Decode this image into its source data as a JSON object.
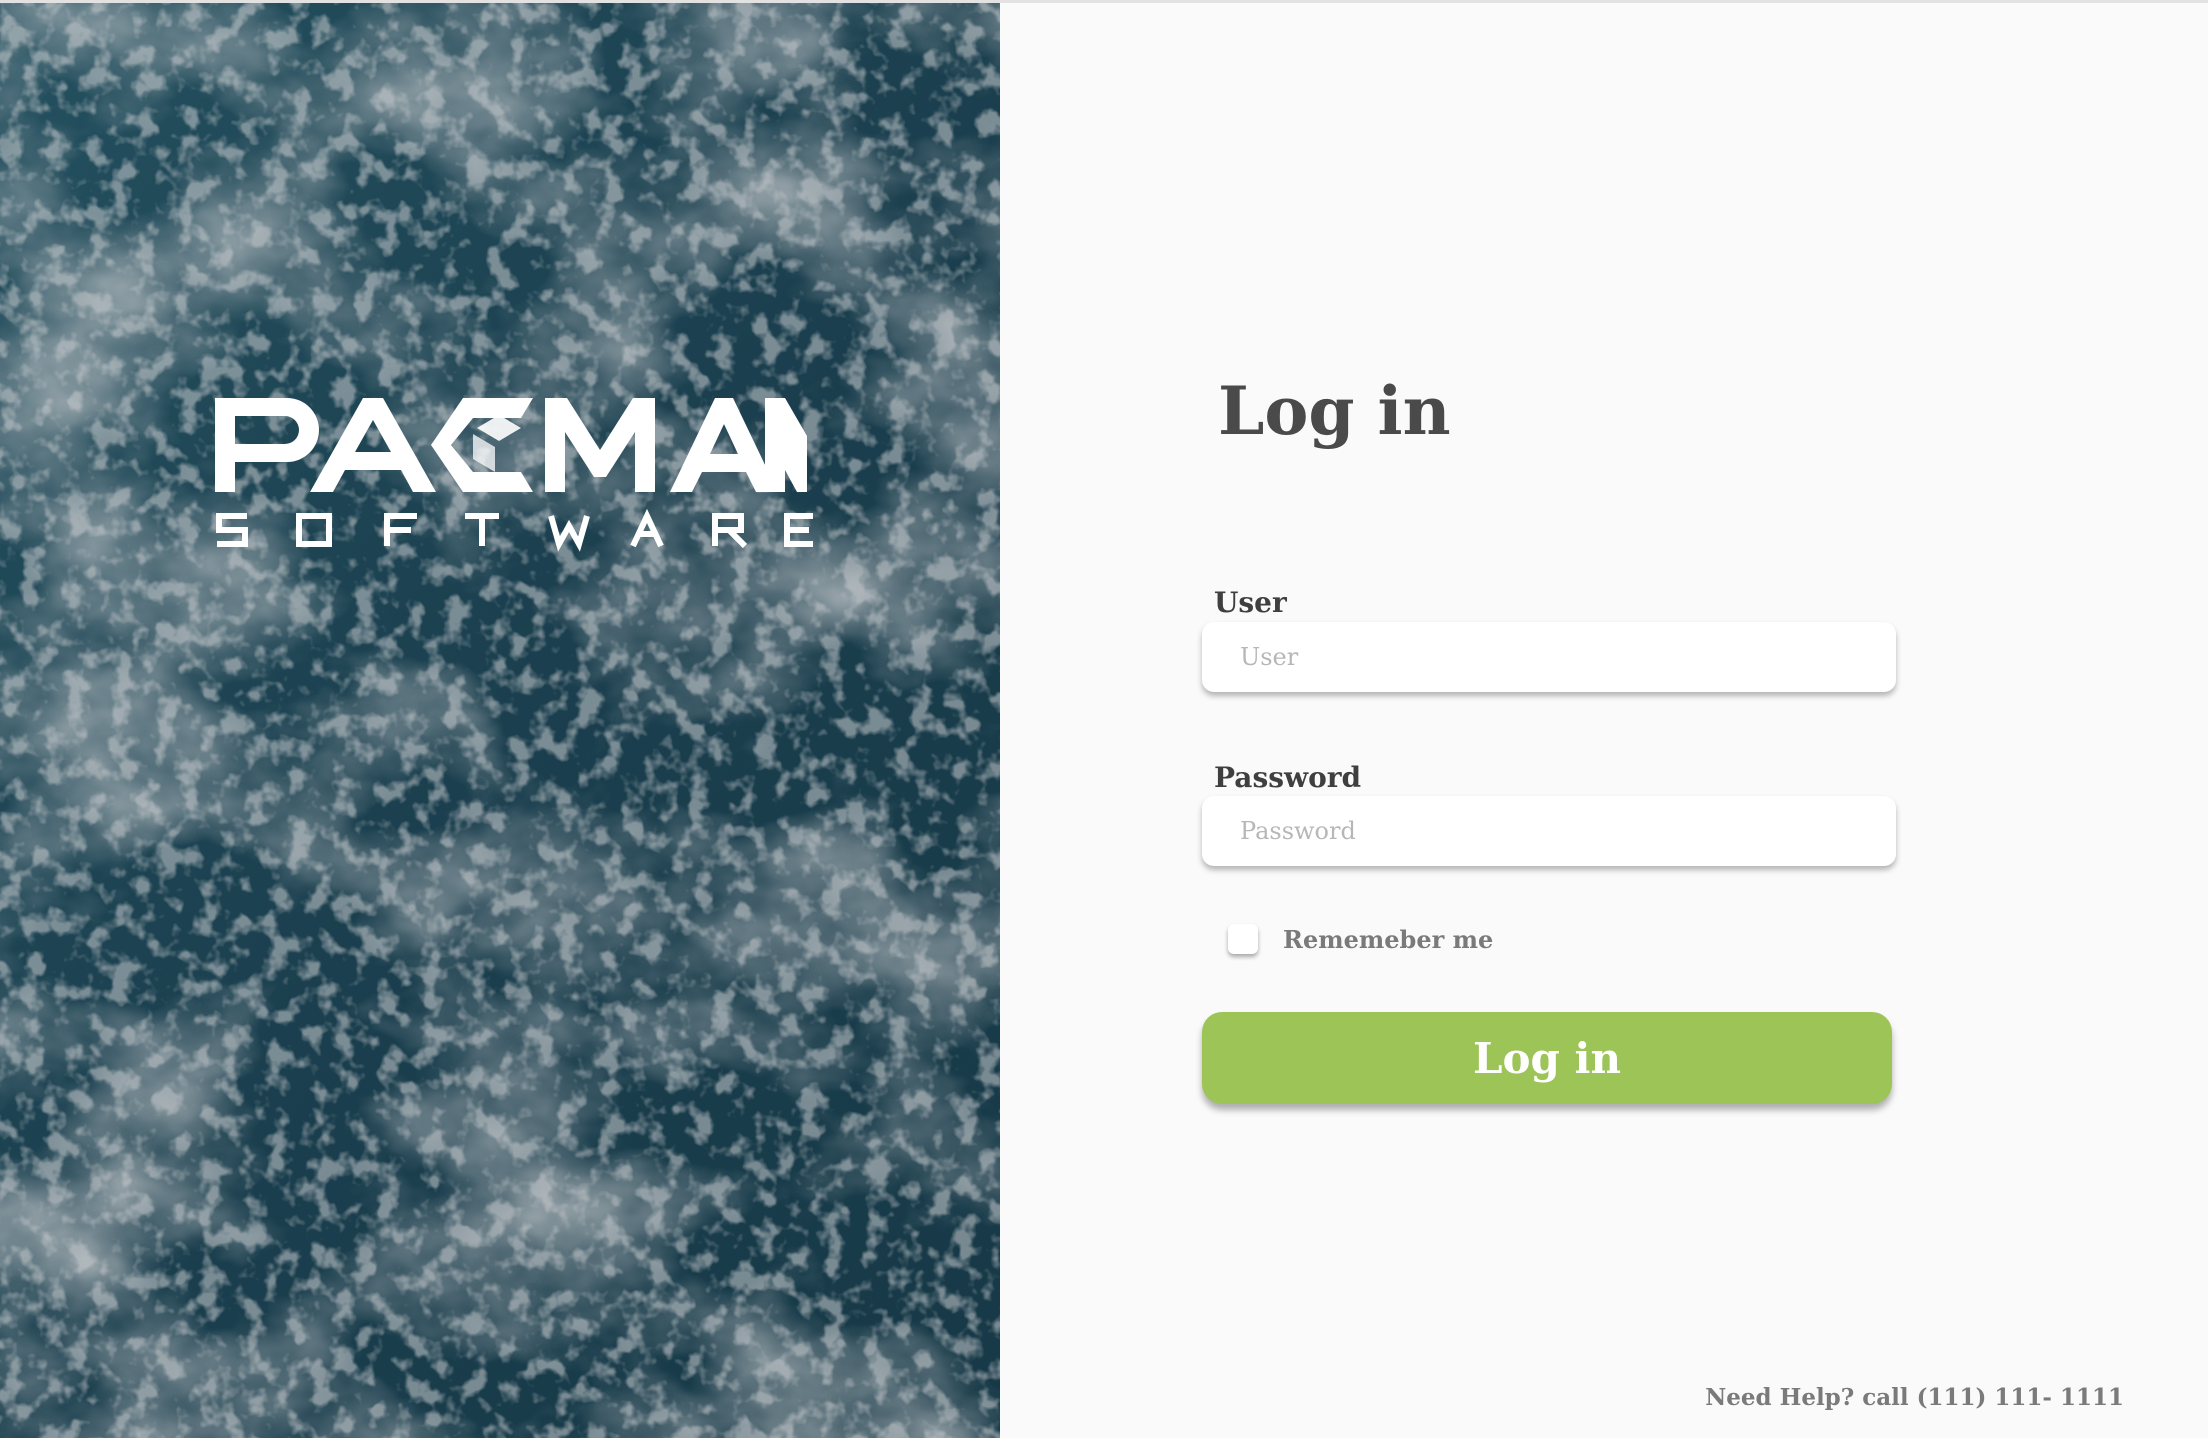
{
  "brand": {
    "name": "PACMAN",
    "tagline": "SOFTWARE"
  },
  "login": {
    "title": "Log in",
    "user_label": "User",
    "user_placeholder": "User",
    "user_value": "",
    "password_label": "Password",
    "password_placeholder": "Password",
    "password_value": "",
    "remember_label": "Rememeber me",
    "remember_checked": false,
    "submit_label": "Log in"
  },
  "footer": {
    "help_text": "Need Help? call (111) 111- 1111"
  },
  "colors": {
    "accent_button": "#9cc456",
    "hero_background": "#1f4656",
    "panel_background": "#fafafa",
    "title_text": "#4a4a4a"
  },
  "icons": {
    "logo_mark": "pacman-software-logo"
  }
}
